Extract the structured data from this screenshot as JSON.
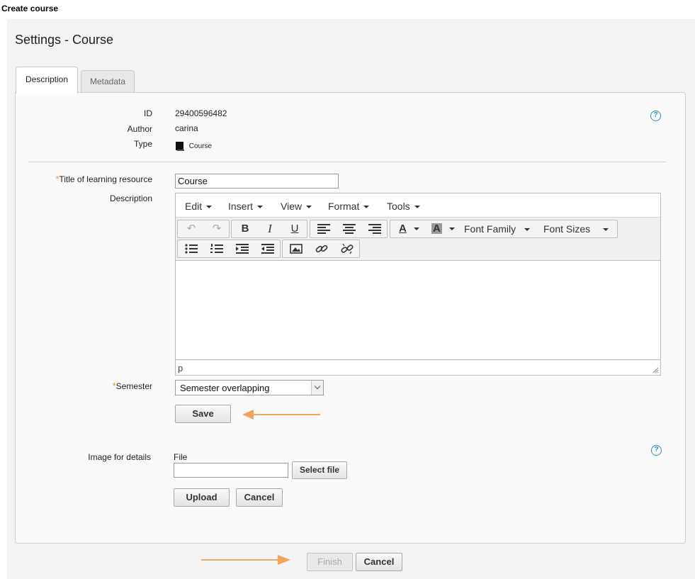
{
  "window": {
    "title": "Create course"
  },
  "page": {
    "title": "Settings - Course"
  },
  "tabs": [
    {
      "label": "Description"
    },
    {
      "label": "Metadata"
    }
  ],
  "info": {
    "id_label": "ID",
    "id_value": "29400596482",
    "author_label": "Author",
    "author_value": "carina",
    "type_label": "Type",
    "type_value": "Course"
  },
  "form": {
    "title_label": "Title of learning resource",
    "title_value": "Course",
    "description_label": "Description",
    "semester_label": "Semester",
    "semester_value": "Semester overlapping",
    "save_label": "Save",
    "image_label": "Image for details",
    "file_label": "File",
    "file_value": "",
    "select_file_label": "Select file",
    "upload_label": "Upload",
    "cancel_label": "Cancel",
    "help_symbol": "?",
    "required_symbol": "*"
  },
  "editor": {
    "menus": [
      "Edit",
      "Insert",
      "View",
      "Format",
      "Tools"
    ],
    "font_family_label": "Font Family",
    "font_sizes_label": "Font Sizes",
    "status_path": "p"
  },
  "footer": {
    "finish_label": "Finish",
    "cancel_label": "Cancel"
  },
  "colors": {
    "accent_arrow": "#f0a45c",
    "help_icon": "#2a8fbd",
    "required": "#e8943a"
  }
}
